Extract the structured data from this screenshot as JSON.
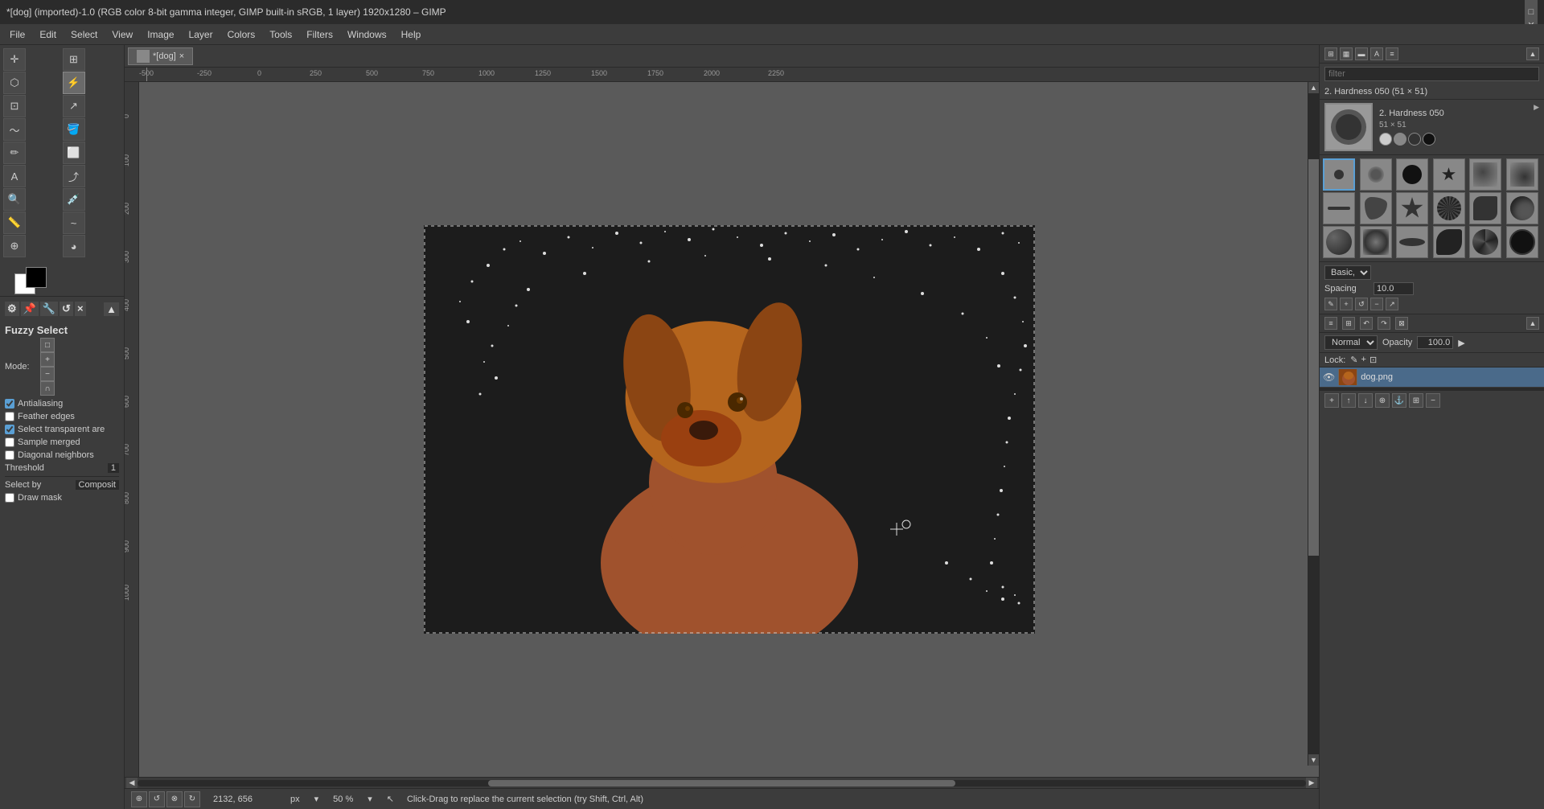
{
  "titlebar": {
    "title": "*[dog] (imported)-1.0 (RGB color 8-bit gamma integer, GIMP built-in sRGB, 1 layer) 1920x1280 – GIMP",
    "controls": [
      "minimize",
      "maximize",
      "close"
    ]
  },
  "menubar": {
    "items": [
      "File",
      "Edit",
      "Select",
      "View",
      "Image",
      "Layer",
      "Colors",
      "Tools",
      "Filters",
      "Windows",
      "Help"
    ]
  },
  "toolbox": {
    "tools": [
      {
        "name": "move-tool",
        "icon": "✛"
      },
      {
        "name": "alignment-tool",
        "icon": "⊞"
      },
      {
        "name": "free-select-tool",
        "icon": "⬡"
      },
      {
        "name": "fuzzy-select-tool",
        "icon": "⚡",
        "active": true
      },
      {
        "name": "crop-tool",
        "icon": "⊡"
      },
      {
        "name": "transform-tool",
        "icon": "↗"
      },
      {
        "name": "warp-tool",
        "icon": "〜"
      },
      {
        "name": "bucket-fill-tool",
        "icon": "🪣"
      },
      {
        "name": "pencil-tool",
        "icon": "✏"
      },
      {
        "name": "eraser-tool",
        "icon": "⬜"
      },
      {
        "name": "text-tool",
        "icon": "A"
      },
      {
        "name": "path-tool",
        "icon": "⤴"
      },
      {
        "name": "zoom-tool",
        "icon": "🔍"
      },
      {
        "name": "eyedropper-tool",
        "icon": "💉"
      },
      {
        "name": "measure-tool",
        "icon": "📏"
      },
      {
        "name": "smudge-tool",
        "icon": "~"
      },
      {
        "name": "dodge-burn-tool",
        "icon": "◕"
      },
      {
        "name": "clone-tool",
        "icon": "⊕"
      }
    ],
    "fg_color": "#000000",
    "bg_color": "#ffffff"
  },
  "tool_options": {
    "title": "Fuzzy Select",
    "mode_label": "Mode:",
    "mode_buttons": [
      "replace",
      "add",
      "subtract",
      "intersect"
    ],
    "antialiasing": {
      "label": "Antialiasing",
      "checked": true
    },
    "feather_edges": {
      "label": "Feather edges",
      "checked": false
    },
    "select_transparent": {
      "label": "Select transparent are",
      "checked": true
    },
    "sample_merged": {
      "label": "Sample merged",
      "checked": false
    },
    "diagonal_neighbors": {
      "label": "Diagonal neighbors",
      "checked": false
    },
    "threshold": {
      "label": "Threshold",
      "value": "1"
    },
    "select_by": {
      "label": "Select by",
      "value": "Composit"
    },
    "draw_mask": {
      "label": "Draw mask",
      "checked": false
    }
  },
  "canvas": {
    "tab_title": "*[dog]",
    "image_size": "1920x1280",
    "zoom": "50 %",
    "coords": "2132, 656",
    "unit": "px",
    "status_msg": "Click-Drag to replace the current selection (try Shift, Ctrl, Alt)",
    "ruler_marks_h": [
      "-500",
      "-250",
      "0",
      "250",
      "500",
      "750",
      "1000",
      "1250",
      "1500",
      "1750",
      "2000",
      "2250"
    ],
    "ruler_marks_v": [
      "0",
      "100",
      "200",
      "300",
      "400",
      "500",
      "600",
      "700",
      "800",
      "900",
      "1000"
    ]
  },
  "brushes_panel": {
    "filter_placeholder": "filter",
    "brush_info": "2. Hardness 050 (51 × 51)",
    "spacing_label": "Spacing",
    "spacing_value": "10.0",
    "brushes": [
      {
        "name": "small-hard-round",
        "type": "hard-round"
      },
      {
        "name": "medium-round",
        "type": "round"
      },
      {
        "name": "hard-round-dark",
        "type": "dark"
      },
      {
        "name": "star-brush",
        "type": "star"
      },
      {
        "name": "scatter-1",
        "type": "scatter"
      },
      {
        "name": "scatter-2",
        "type": "scatter"
      },
      {
        "name": "line-brush",
        "type": "line"
      },
      {
        "name": "splat-1",
        "type": "splat"
      },
      {
        "name": "splat-2",
        "type": "splat"
      },
      {
        "name": "splat-3",
        "type": "splat"
      },
      {
        "name": "grunge-1",
        "type": "grunge"
      },
      {
        "name": "grunge-2",
        "type": "grunge"
      },
      {
        "name": "dots-1",
        "type": "dots"
      },
      {
        "name": "dots-2",
        "type": "dots"
      },
      {
        "name": "texture-1",
        "type": "texture"
      },
      {
        "name": "texture-2",
        "type": "texture"
      },
      {
        "name": "large-soft",
        "type": "soft"
      },
      {
        "name": "large-dark",
        "type": "dark"
      }
    ]
  },
  "layers_panel": {
    "title": "Layers",
    "mode_options": [
      "Normal"
    ],
    "current_mode": "Normal",
    "opacity_label": "Opacity",
    "opacity_value": "100.0",
    "lock_label": "Lock:",
    "layers": [
      {
        "name": "dog.png",
        "visible": true,
        "active": true
      }
    ]
  },
  "colors": {
    "accent": "#5a9fd4",
    "bg_dark": "#2b2b2b",
    "bg_mid": "#3c3c3c",
    "bg_panel": "#3a3a3a"
  }
}
